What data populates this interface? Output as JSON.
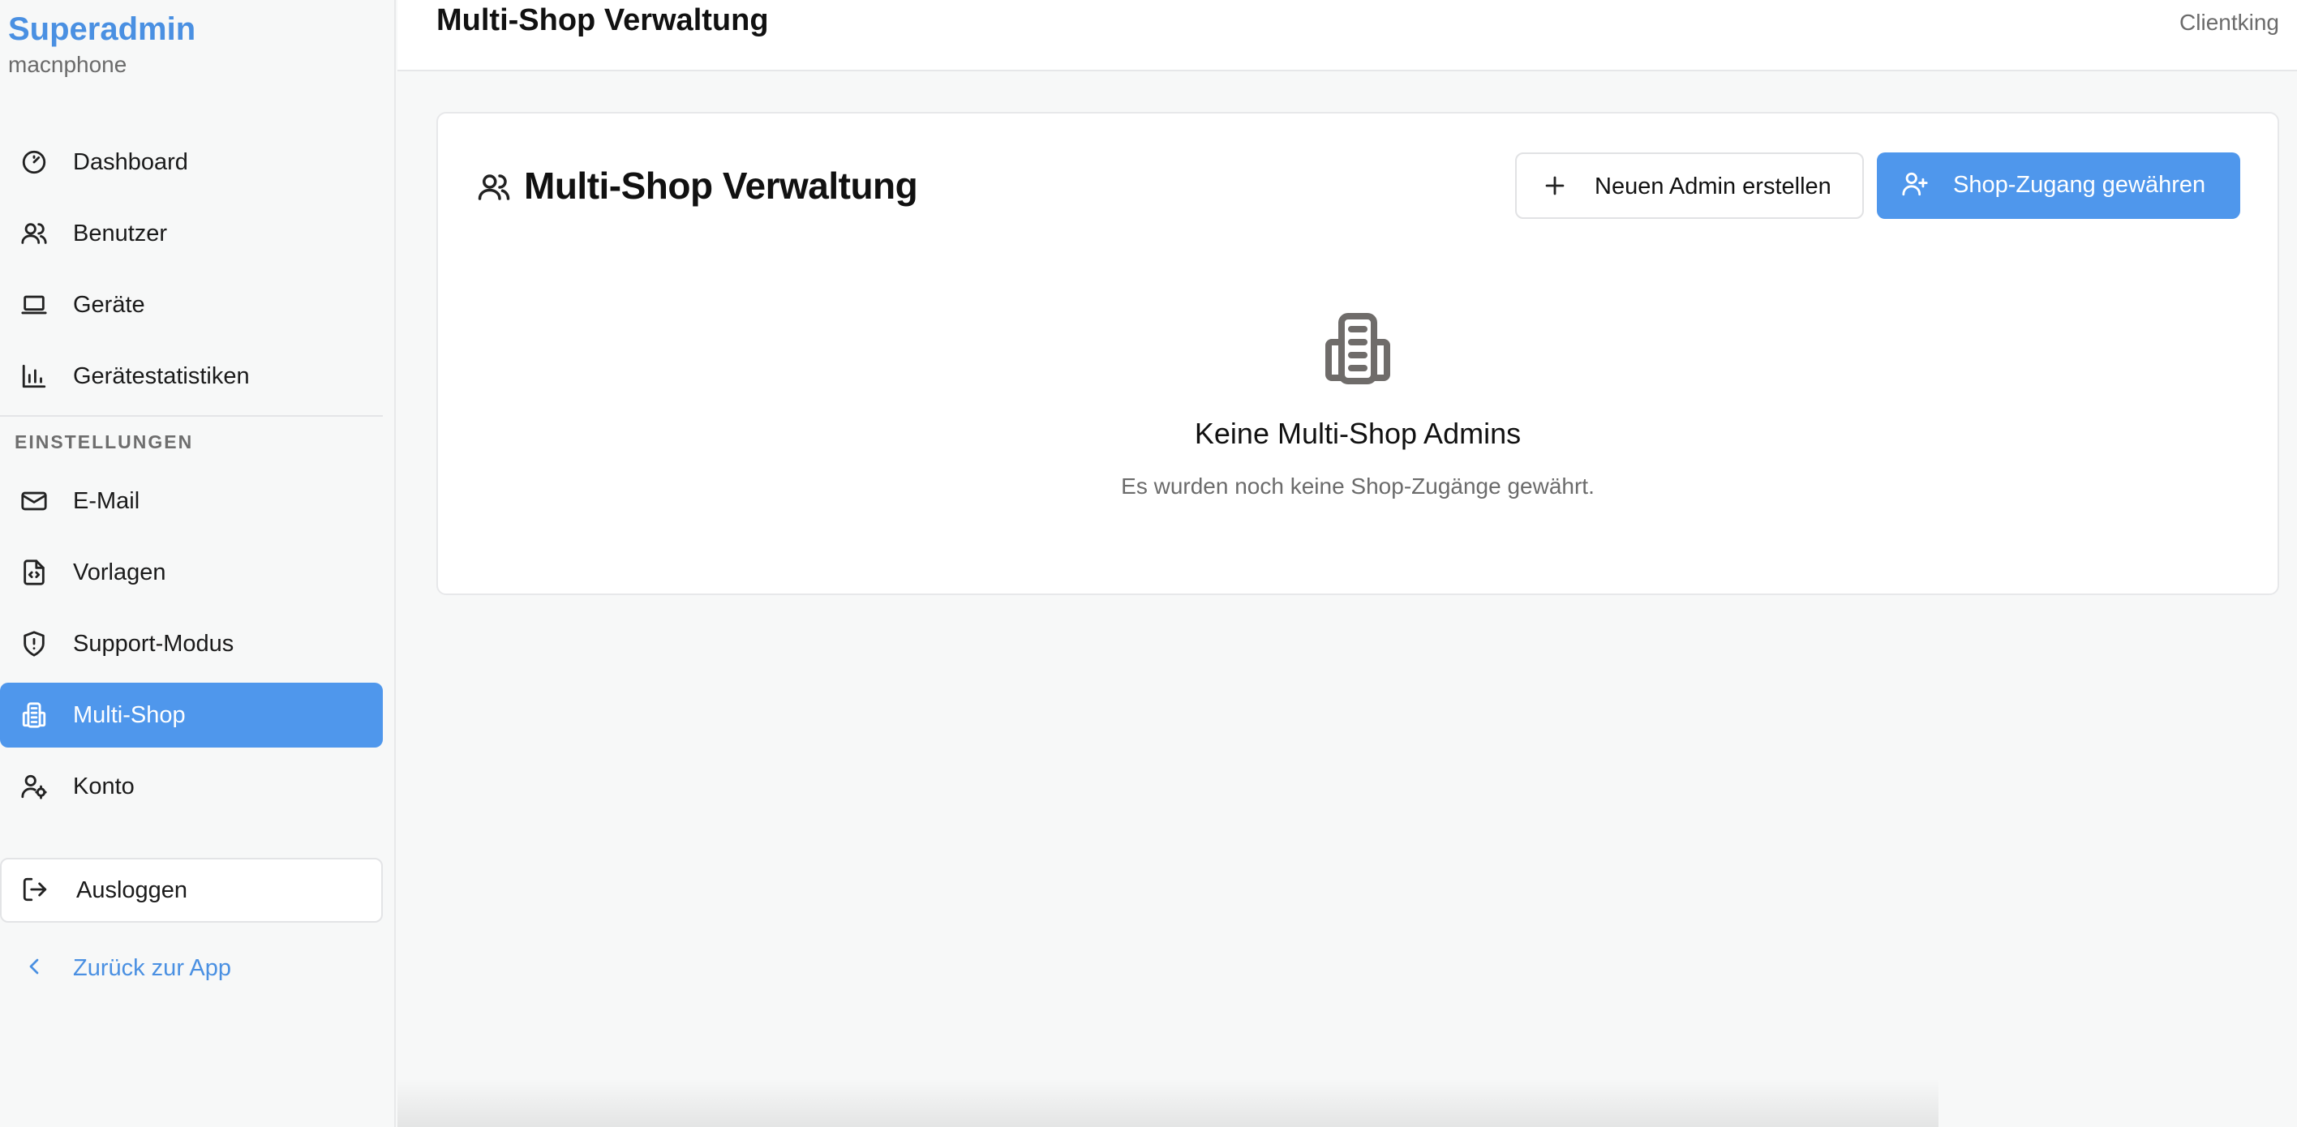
{
  "sidebar": {
    "brand_title": "Superadmin",
    "brand_subtitle": "macnphone",
    "items": [
      {
        "label": "Dashboard",
        "icon": "gauge-icon"
      },
      {
        "label": "Benutzer",
        "icon": "users-icon"
      },
      {
        "label": "Geräte",
        "icon": "laptop-icon"
      },
      {
        "label": "Gerätestatistiken",
        "icon": "bar-chart-icon"
      }
    ],
    "section_label": "EINSTELLUNGEN",
    "settings_items": [
      {
        "label": "E-Mail",
        "icon": "mail-icon"
      },
      {
        "label": "Vorlagen",
        "icon": "file-code-icon"
      },
      {
        "label": "Support-Modus",
        "icon": "shield-alert-icon"
      },
      {
        "label": "Multi-Shop",
        "icon": "building-icon",
        "active": true
      },
      {
        "label": "Konto",
        "icon": "user-cog-icon"
      }
    ],
    "logout_label": "Ausloggen",
    "back_label": "Zurück zur App"
  },
  "topbar": {
    "title": "Multi-Shop Verwaltung",
    "right_text": "Clientking"
  },
  "card": {
    "title": "Multi-Shop Verwaltung",
    "new_admin_label": "Neuen Admin erstellen",
    "grant_access_label": "Shop-Zugang gewähren",
    "empty_title": "Keine Multi-Shop Admins",
    "empty_subtitle": "Es wurden noch keine Shop-Zugänge gewährt."
  },
  "colors": {
    "accent": "#4f97ec",
    "brand": "#4a90e2",
    "muted_text": "#6b6b6b",
    "background": "#f7f8f8"
  }
}
